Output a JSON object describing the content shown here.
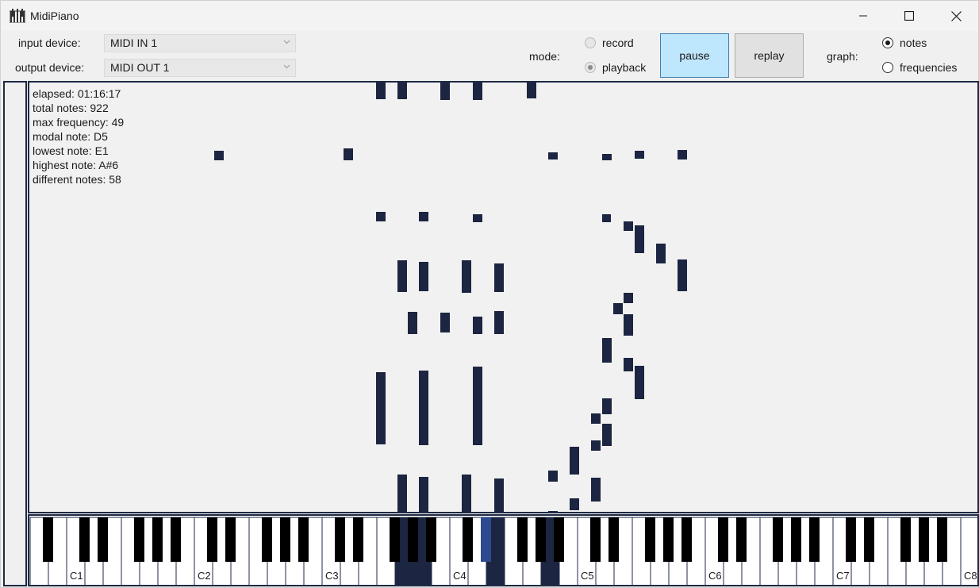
{
  "window": {
    "title": "MidiPiano",
    "icon": "piano-app-icon"
  },
  "toolbar": {
    "input_label": "input device:",
    "input_value": "MIDI IN 1",
    "output_label": "output device:",
    "output_value": "MIDI OUT 1",
    "mode_label": "mode:",
    "mode_options": [
      {
        "label": "record",
        "selected": false,
        "enabled": false
      },
      {
        "label": "playback",
        "selected": true,
        "enabled": false
      }
    ],
    "pause_label": "pause",
    "replay_label": "replay",
    "graph_label": "graph:",
    "graph_options": [
      {
        "label": "notes",
        "selected": true
      },
      {
        "label": "frequencies",
        "selected": false
      }
    ]
  },
  "stats": {
    "elapsed": "elapsed: 01:16:17",
    "total_notes": "total notes: 922",
    "max_frequency": "max frequency: 49",
    "modal_note": "modal note: D5",
    "lowest_note": "lowest note: E1",
    "highest_note": "highest note: A#6",
    "different_notes": "different notes: 58"
  },
  "keyboard": {
    "octave_labels": [
      "C1",
      "C2",
      "C3",
      "C4",
      "C5",
      "C6",
      "C7",
      "C8"
    ],
    "pressed_note_color": "#1c2541",
    "highlight_note_color": "#2e4a8f"
  },
  "colors": {
    "note_block": "#1c2541",
    "frame": "#1e2a44",
    "pause_bg": "#bee6fd"
  }
}
